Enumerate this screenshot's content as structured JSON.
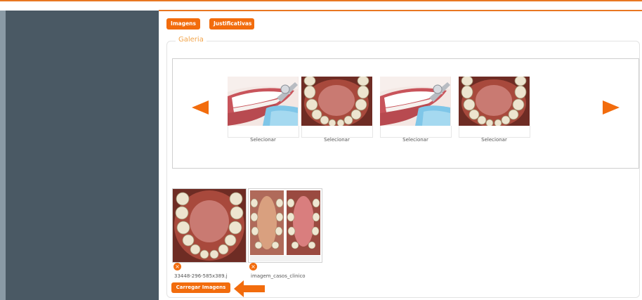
{
  "tabs": {
    "imagens": "Imagens",
    "justificativas": "Justificativas"
  },
  "gallery": {
    "legend": "Galeria",
    "items": [
      {
        "kind": "smile-mirror",
        "select_label": "Selecionar"
      },
      {
        "kind": "lower-arch",
        "select_label": "Selecionar"
      },
      {
        "kind": "smile-mirror",
        "select_label": "Selecionar"
      },
      {
        "kind": "lower-arch",
        "select_label": "Selecionar"
      }
    ],
    "prev_icon": "arrow-left-icon",
    "next_icon": "arrow-right-icon"
  },
  "uploads": [
    {
      "filename": "33448-296-585x389.j",
      "remove_icon": "close-icon",
      "remove_glyph": "×"
    },
    {
      "filename": "imagem_casos_clinico",
      "remove_icon": "close-icon",
      "remove_glyph": "×"
    }
  ],
  "upload_button": "Carregar Imagens",
  "colors": {
    "accent": "#f26c0d",
    "sidebar": "#4a5964",
    "legend": "#f2a44a"
  }
}
